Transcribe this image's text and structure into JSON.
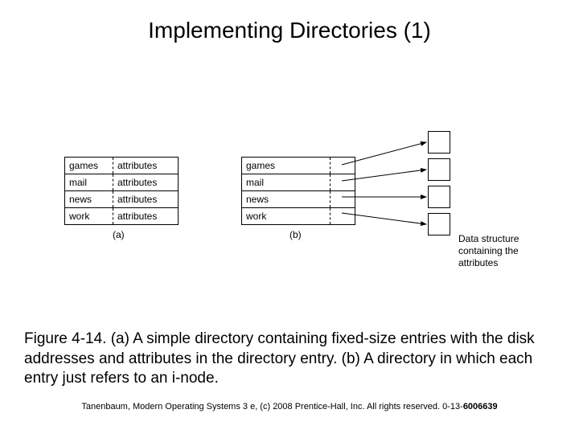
{
  "title": "Implementing Directories (1)",
  "tableA": {
    "rows": [
      {
        "name": "games",
        "attr": "attributes"
      },
      {
        "name": "mail",
        "attr": "attributes"
      },
      {
        "name": "news",
        "attr": "attributes"
      },
      {
        "name": "work",
        "attr": "attributes"
      }
    ],
    "label": "(a)"
  },
  "tableB": {
    "rows": [
      {
        "name": "games"
      },
      {
        "name": "mail"
      },
      {
        "name": "news"
      },
      {
        "name": "work"
      }
    ],
    "label": "(b)"
  },
  "ds_label": "Data structure containing the attributes",
  "caption": "Figure 4-14. (a) A simple directory containing fixed-size entries with the disk addresses and attributes in the directory entry. (b) A directory in which each entry just refers to an i-node.",
  "footer_pre": "Tanenbaum, Modern Operating Systems 3 e, (c) 2008 Prentice-Hall, Inc. All rights reserved. 0-13-",
  "footer_isbn": "6006639"
}
